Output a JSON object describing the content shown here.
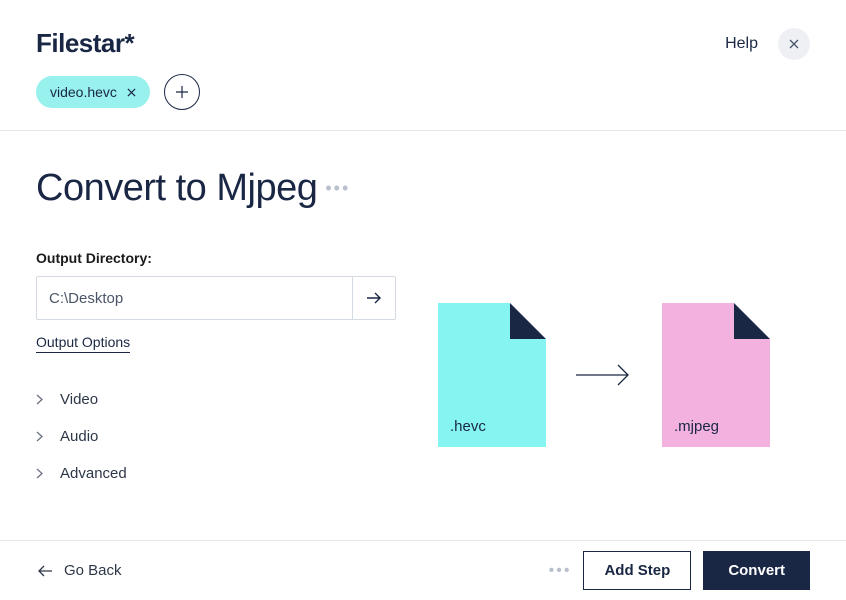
{
  "header": {
    "logo": "Filestar*",
    "help_label": "Help"
  },
  "file_chip": {
    "name": "video.hevc"
  },
  "page": {
    "title": "Convert to Mjpeg",
    "output_dir_label": "Output Directory:",
    "output_dir_value": "C:\\Desktop",
    "output_options_label": "Output Options"
  },
  "accordion": {
    "items": [
      {
        "label": "Video"
      },
      {
        "label": "Audio"
      },
      {
        "label": "Advanced"
      }
    ]
  },
  "illustration": {
    "from_ext": ".hevc",
    "to_ext": ".mjpeg"
  },
  "footer": {
    "go_back_label": "Go Back",
    "add_step_label": "Add Step",
    "convert_label": "Convert"
  }
}
